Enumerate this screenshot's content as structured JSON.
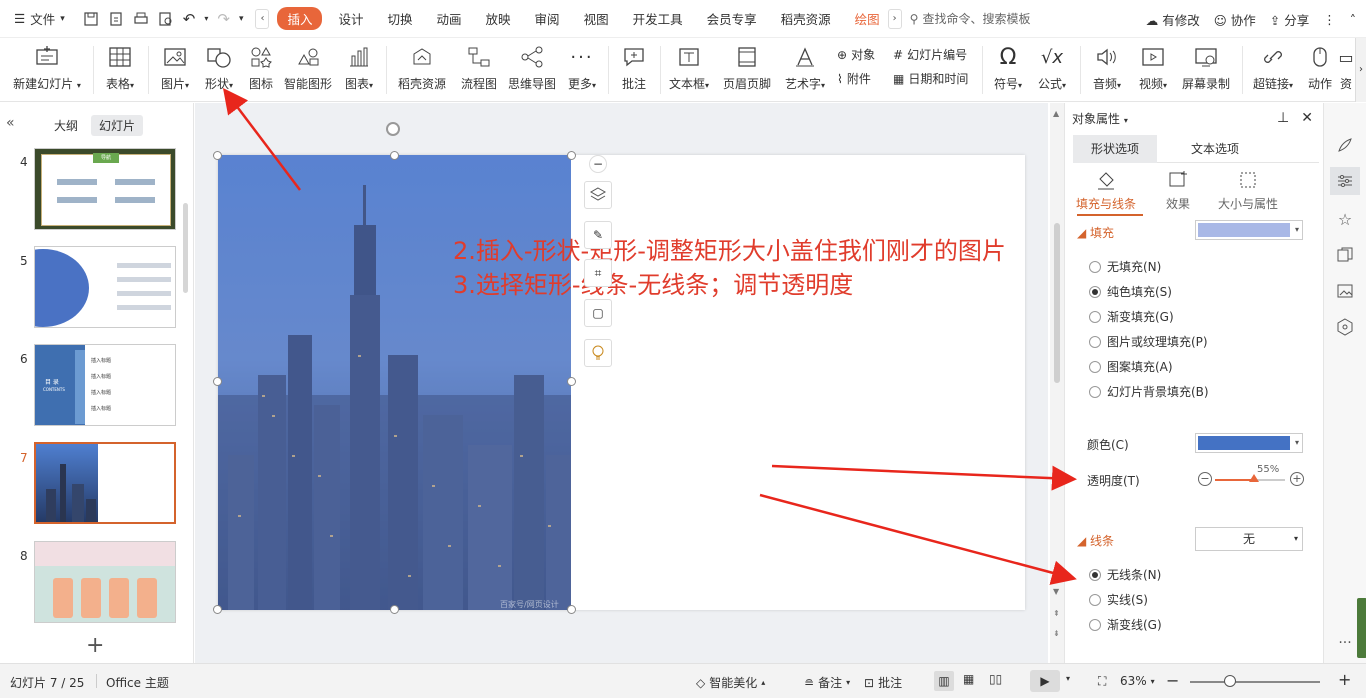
{
  "menu": {
    "file_label": "文件",
    "tabs": [
      "设计",
      "切换",
      "动画",
      "放映",
      "审阅",
      "视图",
      "开发工具",
      "会员专享",
      "稻壳资源"
    ],
    "active_tab": "插入",
    "draw_tab": "绘图",
    "search_placeholder": "查找命令、搜索模板",
    "right": {
      "changes": "有修改",
      "collab": "协作",
      "share": "分享"
    }
  },
  "ribbon": {
    "new_slide": "新建幻灯片",
    "table": "表格",
    "picture": "图片",
    "shape": "形状",
    "icon": "图标",
    "smart_shape": "智能图形",
    "chart": "图表",
    "docer": "稻壳资源",
    "flowchart": "流程图",
    "mindmap": "思维导图",
    "more": "更多",
    "comment": "批注",
    "textbox": "文本框",
    "header_footer": "页眉页脚",
    "wordart": "艺术字",
    "object": "对象",
    "slide_number": "幻灯片编号",
    "attachment": "附件",
    "datetime": "日期和时间",
    "symbol": "符号",
    "formula": "公式",
    "audio": "音频",
    "video": "视频",
    "screen_record": "屏幕录制",
    "hyperlink": "超链接",
    "action": "动作",
    "res": "资"
  },
  "left_panel": {
    "tab_outline": "大纲",
    "tab_slides": "幻灯片",
    "slides": [
      {
        "num": "4",
        "selected": false
      },
      {
        "num": "5",
        "selected": false
      },
      {
        "num": "6",
        "selected": false
      },
      {
        "num": "7",
        "selected": true
      },
      {
        "num": "8",
        "selected": false
      }
    ],
    "thumb6_title": "目 录",
    "thumb6_sub": "CONTENTS",
    "thumb_item": "插入标题",
    "thumb4_head": "导航"
  },
  "slide": {
    "annotation_line1": "2.插入-形状-矩形-调整矩形大小盖住我们刚才的图片",
    "annotation_line2": "3.选择矩形-线条-无线条；调节透明度",
    "watermark": "百家号/网页设计"
  },
  "props": {
    "title": "对象属性",
    "tab_shape": "形状选项",
    "tab_text": "文本选项",
    "sub_fill": "填充与线条",
    "sub_effect": "效果",
    "sub_size": "大小与属性",
    "fill_section": "填充",
    "fill_options": [
      {
        "label": "无填充(N)",
        "checked": false
      },
      {
        "label": "纯色填充(S)",
        "checked": true
      },
      {
        "label": "渐变填充(G)",
        "checked": false
      },
      {
        "label": "图片或纹理填充(P)",
        "checked": false
      },
      {
        "label": "图案填充(A)",
        "checked": false
      },
      {
        "label": "幻灯片背景填充(B)",
        "checked": false
      }
    ],
    "color_label": "颜色(C)",
    "transparency_label": "透明度(T)",
    "transparency_value": "55%",
    "transparency_fraction": 0.55,
    "line_section": "线条",
    "line_dropdown": "无",
    "line_options": [
      {
        "label": "无线条(N)",
        "checked": true
      },
      {
        "label": "实线(S)",
        "checked": false
      },
      {
        "label": "渐变线(G)",
        "checked": false
      }
    ],
    "colors": {
      "fill_top": "#a9b8e6",
      "fill_color": "#4472c4",
      "accent": "#d4632c"
    }
  },
  "status": {
    "slide_info": "幻灯片 7 / 25",
    "theme": "Office 主题",
    "beautify": "智能美化",
    "notes": "备注",
    "comments": "批注",
    "zoom": "63%"
  }
}
